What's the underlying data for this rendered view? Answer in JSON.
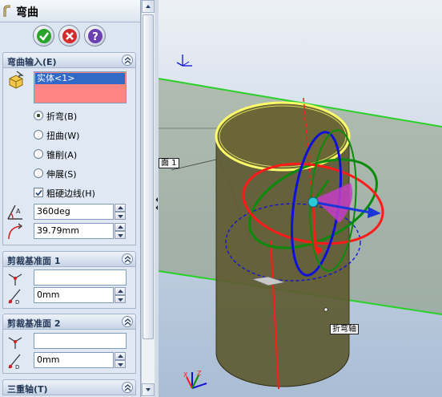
{
  "feature": {
    "title": "弯曲"
  },
  "action_buttons": {
    "ok": "ok",
    "cancel": "cancel",
    "help": "help"
  },
  "bend_input": {
    "header": "弯曲输入(E)",
    "selection": [
      "实体<1>"
    ],
    "options": [
      {
        "label": "折弯(B)",
        "selected": true
      },
      {
        "label": "扭曲(W)",
        "selected": false
      },
      {
        "label": "锥削(A)",
        "selected": false
      },
      {
        "label": "伸展(S)",
        "selected": false
      }
    ],
    "rigid_edges": {
      "label": "粗硬边线(H)",
      "checked": true
    },
    "angle": "360deg",
    "radius": "39.79mm"
  },
  "trim_plane1": {
    "header": "剪裁基准面 1",
    "reference": "",
    "distance": "0mm"
  },
  "trim_plane2": {
    "header": "剪裁基准面 2",
    "reference": "",
    "distance": "0mm"
  },
  "triad": {
    "header": "三重轴(T)"
  },
  "viewport": {
    "plane_tag": "面 1",
    "axis_tag": "折弯轴"
  },
  "colors": {
    "selection_list": "#ff8484",
    "selected_item": "#3169c6",
    "cylinder": "#5e5a32",
    "plane": "#8a9b7c",
    "plane_edge": "#2ad02a",
    "ring_red": "#ff1a1a",
    "ring_green": "#0b8a0b",
    "ring_blue": "#1010d8"
  }
}
